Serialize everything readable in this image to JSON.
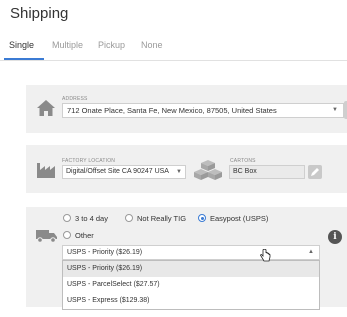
{
  "header": {
    "title": "Shipping"
  },
  "tabs": [
    {
      "label": "Single",
      "active": true
    },
    {
      "label": "Multiple"
    },
    {
      "label": "Pickup"
    },
    {
      "label": "None"
    }
  ],
  "address": {
    "label": "ADDRESS",
    "value": "712 Onate Place, Santa Fe, New Mexico, 87505, United States",
    "icon": "house-icon"
  },
  "factory": {
    "label": "FACTORY LOCATION",
    "value": "Digital/Offset Site CA 90247 USA",
    "icon": "factory-icon"
  },
  "cartons": {
    "label": "CARTONS",
    "value": "BC Box",
    "icon": "boxes-icon"
  },
  "shipping": {
    "icon": "truck-icon",
    "options": [
      {
        "label": "3 to 4 day",
        "selected": false
      },
      {
        "label": "Not Really TIG",
        "selected": false
      },
      {
        "label": "Easypost (USPS)",
        "selected": true
      },
      {
        "label": "Other",
        "selected": false
      }
    ],
    "selected_rate": "USPS - Priority ($26.19)",
    "rates": [
      "USPS - Priority ($26.19)",
      "USPS - ParcelSelect ($27.57)",
      "USPS - Express ($129.38)"
    ],
    "info_symbol": "i"
  },
  "colors": {
    "accent": "#3b7bd4",
    "panel": "#f0f0f0"
  }
}
